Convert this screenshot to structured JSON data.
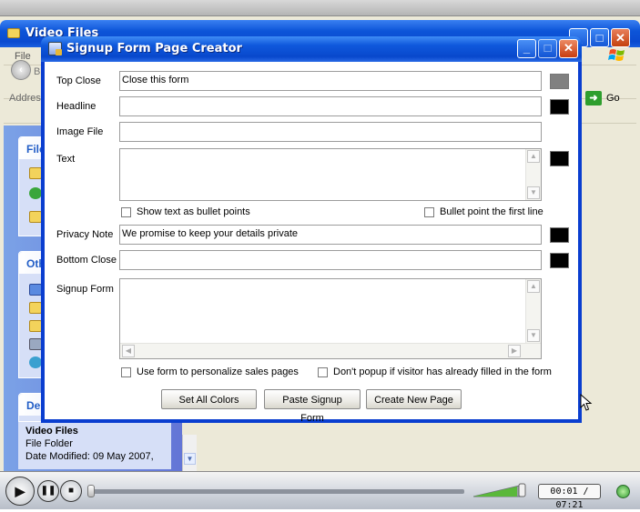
{
  "explorer": {
    "title": "Video Files",
    "menu_file": "File",
    "back_label": "B",
    "address_label": "Address",
    "go_label": "Go",
    "panels": {
      "file_tasks_head": "File",
      "other_places_head": "Oth",
      "details_head": "De"
    },
    "details": {
      "name": "Video Files",
      "type": "File Folder",
      "date": "Date Modified: 09 May 2007,"
    }
  },
  "dialog": {
    "title": "Signup Form Page Creator",
    "fields": {
      "top_close": {
        "label": "Top Close",
        "value": "Close this form",
        "color": "#808080"
      },
      "headline": {
        "label": "Headline",
        "value": "",
        "color": "#000000"
      },
      "image_file": {
        "label": "Image File",
        "value": ""
      },
      "text": {
        "label": "Text",
        "value": "",
        "color": "#000000"
      },
      "privacy_note": {
        "label": "Privacy Note",
        "value": "We promise to keep your details private",
        "color": "#000000"
      },
      "bottom_close": {
        "label": "Bottom Close",
        "value": "",
        "color": "#000000"
      },
      "signup_form": {
        "label": "Signup Form",
        "value": ""
      }
    },
    "checkboxes": {
      "bullets": "Show text as bullet points",
      "bullet_first": "Bullet point the first line",
      "personalize": "Use form to personalize sales pages",
      "no_popup": "Don't popup if visitor has already filled in the form"
    },
    "buttons": {
      "set_colors": "Set All Colors",
      "paste_form": "Paste Signup Form",
      "create_page": "Create New Page"
    }
  },
  "player": {
    "time": "00:01 / 07:21",
    "progress": 0.0
  }
}
